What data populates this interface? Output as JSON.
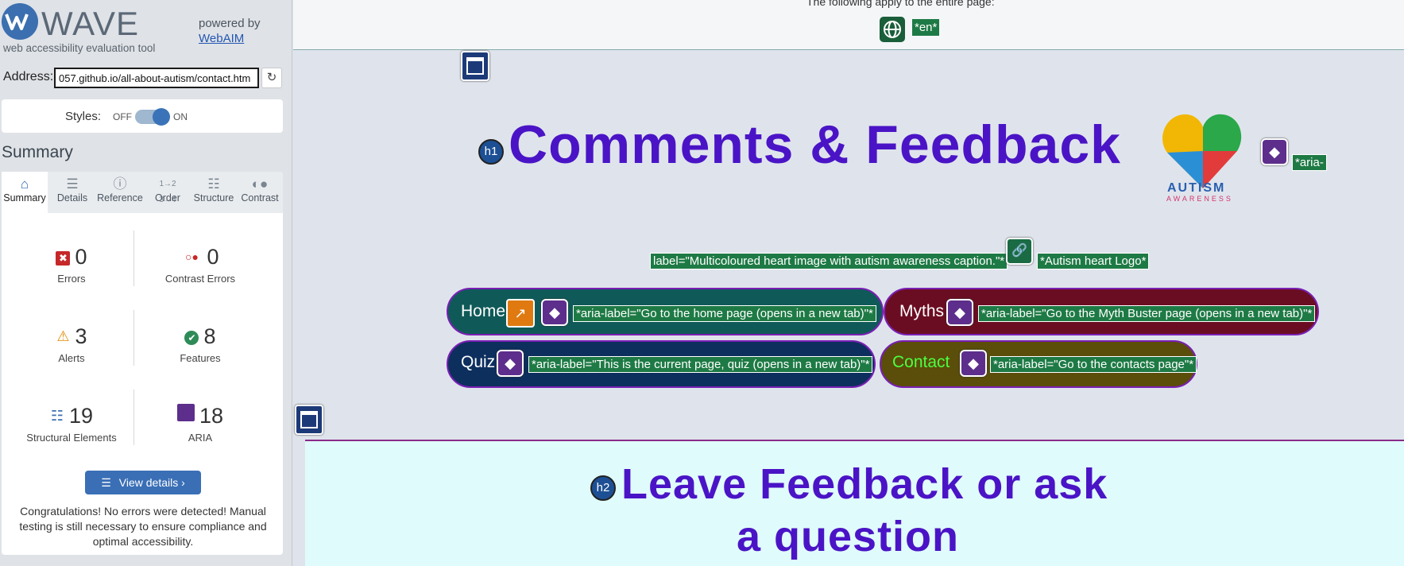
{
  "sidebar": {
    "logo_word": "WAVE",
    "tagline": "web accessibility evaluation tool",
    "powered_by": "powered by",
    "webaim_link": "WebAIM",
    "address_label": "Address:",
    "address_value": "057.github.io/all-about-autism/contact.htm",
    "styles_label": "Styles:",
    "styles_off": "OFF",
    "styles_on": "ON",
    "summary_title": "Summary",
    "tabs": [
      {
        "label": "Summary",
        "icon": "home-icon"
      },
      {
        "label": "Details",
        "icon": "list-icon"
      },
      {
        "label": "Reference",
        "icon": "info-icon"
      },
      {
        "label": "Order",
        "icon": "order-icon"
      },
      {
        "label": "Structure",
        "icon": "structure-icon"
      },
      {
        "label": "Contrast",
        "icon": "contrast-icon"
      }
    ],
    "stats": {
      "errors": {
        "value": "0",
        "label": "Errors"
      },
      "contrast_errors": {
        "value": "0",
        "label": "Contrast Errors"
      },
      "alerts": {
        "value": "3",
        "label": "Alerts"
      },
      "features": {
        "value": "8",
        "label": "Features"
      },
      "structural": {
        "value": "19",
        "label": "Structural Elements"
      },
      "aria": {
        "value": "18",
        "label": "ARIA"
      }
    },
    "view_details": "View details ›",
    "congrats": "Congratulations! No errors were detected! Manual testing is still necessary to ensure compliance and optimal accessibility."
  },
  "main": {
    "top_text": "The following apply to the entire page:",
    "lang_tag": "*en*",
    "h1_badge": "h1",
    "h1_text": "Comments & Feedback",
    "aria_partial": "*aria-",
    "logo_autism": "AUTISM",
    "logo_awareness": "AWARENESS",
    "img_label": "label=\"Multicoloured heart image with autism awareness caption.\"*",
    "img_alt": "*Autism heart Logo*",
    "nav": [
      {
        "label": "Home",
        "aria": "*aria-label=\"Go to the home page (opens in a new tab)\"*"
      },
      {
        "label": "Myths",
        "aria": "*aria-label=\"Go to the Myth Buster page (opens in a new tab)\"*"
      },
      {
        "label": "Quiz",
        "aria": "*aria-label=\"This is the current page, quiz (opens in a new tab)\"*"
      },
      {
        "label": "Contact",
        "aria": "*aria-label=\"Go to the contacts page\"*"
      }
    ],
    "h2_badge": "h2",
    "h2_line1": "Leave Feedback or ask",
    "h2_line2": "a question"
  },
  "colors": {
    "home_pill": "#0f5a58",
    "myths_pill": "#6b0d22",
    "quiz_pill": "#0d2f5e",
    "contact_pill": "#5b4d0a",
    "heading": "#4a14c6",
    "aria_tag": "#1e7a45"
  }
}
